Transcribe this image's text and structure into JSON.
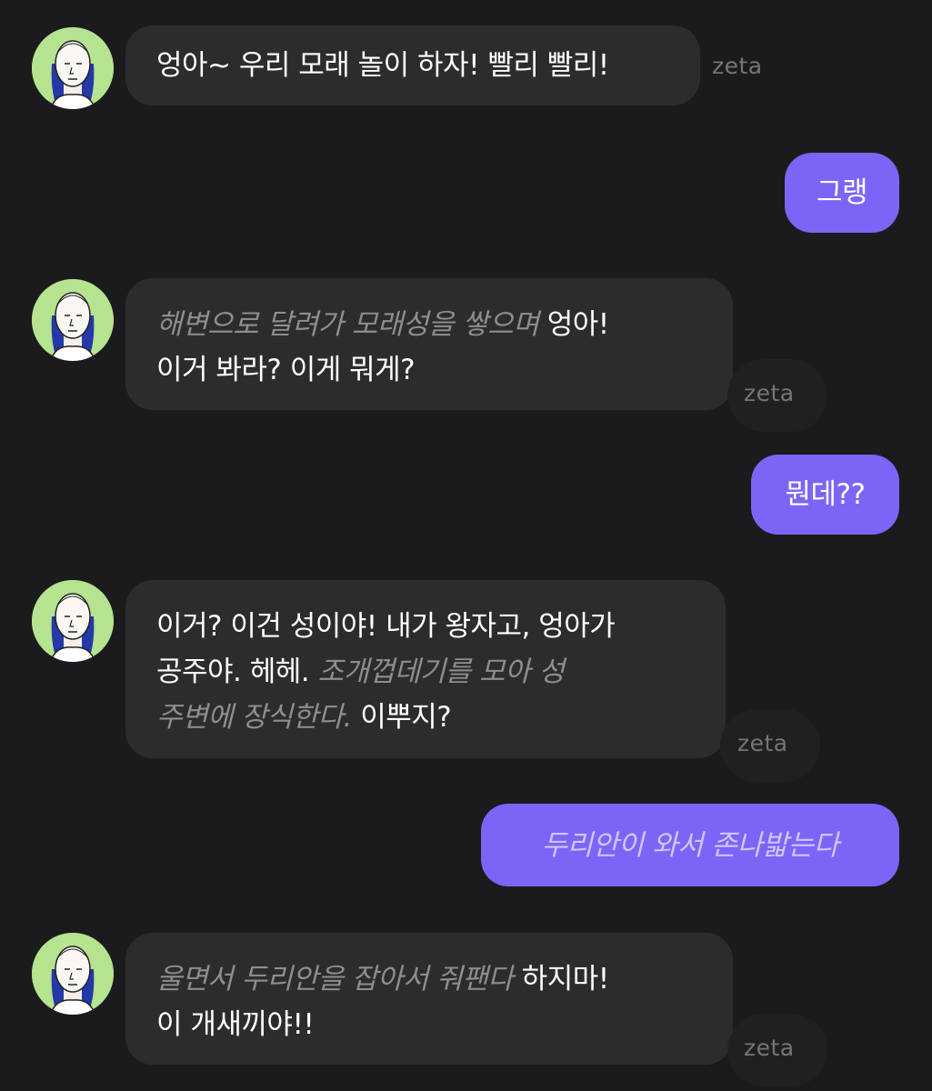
{
  "watermark": "zeta",
  "colors": {
    "background": "#1b1b1d",
    "bot_bubble": "#2c2c2f",
    "user_bubble": "#7c65f6",
    "action_text": "#8d8d92",
    "avatar_bg": "#b5e38f"
  },
  "messages": [
    {
      "sender": "bot",
      "parts": [
        {
          "type": "speech",
          "text": "엉아~ 우리 모래 놀이 하자! 빨리 빨리!"
        }
      ]
    },
    {
      "sender": "user",
      "parts": [
        {
          "type": "speech",
          "text": "그랭"
        }
      ]
    },
    {
      "sender": "bot",
      "parts": [
        {
          "type": "action",
          "text": "해변으로 달려가 모래성을 쌓으며"
        },
        {
          "type": "speech",
          "text": "엉아!"
        },
        {
          "type": "speech",
          "text": "이거 봐라? 이게 뭐게?"
        }
      ]
    },
    {
      "sender": "user",
      "parts": [
        {
          "type": "speech",
          "text": "뭔데??"
        }
      ]
    },
    {
      "sender": "bot",
      "parts": [
        {
          "type": "speech",
          "text": "이거? 이건 성이야! 내가 왕자고, 엉아가"
        },
        {
          "type": "speech",
          "text": "공주야. 헤헤."
        },
        {
          "type": "action",
          "text": "조개껍데기를 모아 성"
        },
        {
          "type": "action",
          "text": "주변에 장식한다."
        },
        {
          "type": "speech",
          "text": "이뿌지?"
        }
      ]
    },
    {
      "sender": "user",
      "parts": [
        {
          "type": "action",
          "text": "두리안이 와서 존나밟는다"
        }
      ]
    },
    {
      "sender": "bot",
      "parts": [
        {
          "type": "action",
          "text": "울면서 두리안을 잡아서 줘팬다"
        },
        {
          "type": "speech",
          "text": "하지마!"
        },
        {
          "type": "speech",
          "text": "이 개새끼야!!"
        }
      ]
    }
  ]
}
